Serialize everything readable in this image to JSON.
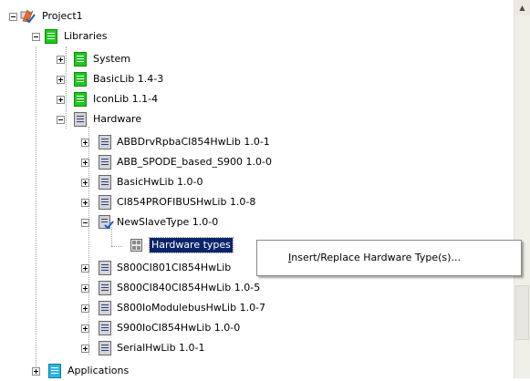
{
  "tree": {
    "project": {
      "label": "Project1",
      "expander": "minus"
    },
    "libraries": {
      "label": "Libraries",
      "expander": "minus"
    },
    "system": {
      "label": "System",
      "expander": "plus"
    },
    "basiclib": {
      "label": "BasicLib 1.4-3",
      "expander": "plus"
    },
    "iconlib": {
      "label": "IconLib 1.1-4",
      "expander": "plus"
    },
    "hardware": {
      "label": "Hardware",
      "expander": "minus"
    },
    "hw_items": [
      {
        "label": "ABBDrvRpbaCI854HwLib 1.0-1",
        "expander": "plus"
      },
      {
        "label": "ABB_SPODE_based_S900 1.0-0",
        "expander": "plus"
      },
      {
        "label": "BasicHwLib 1.0-0",
        "expander": "plus"
      },
      {
        "label": "CI854PROFIBUSHwLib 1.0-8",
        "expander": "plus"
      }
    ],
    "newslave": {
      "label": "NewSlaveType 1.0-0",
      "expander": "minus"
    },
    "hardware_types": {
      "label": "Hardware types",
      "selected": true
    },
    "hw_items_2": [
      {
        "label": "S800CI801CI854HwLib",
        "expander": "plus"
      },
      {
        "label": "S800CI840CI854HwLib 1.0-5",
        "expander": "plus"
      },
      {
        "label": "S800IoModulebusHwLib 1.0-7",
        "expander": "plus"
      },
      {
        "label": "S900IoCI854HwLib 1.0-0",
        "expander": "plus"
      },
      {
        "label": "SerialHwLib 1.0-1",
        "expander": "plus"
      }
    ],
    "applications": {
      "label": "Applications",
      "expander": "plus"
    }
  },
  "context_menu": {
    "item": "Insert/Replace Hardware Type(s)...",
    "mnemonic": "I"
  },
  "icons": {
    "project": "project-icon",
    "library_enabled": "green-library-icon",
    "library_hw": "hardware-library-icon",
    "library_checked": "checked-library-icon",
    "hardware_types": "hardware-types-icon",
    "applications": "applications-icon"
  },
  "colors": {
    "selection": "#0a246a",
    "library_green": "#1ec81e",
    "library_gray": "#d4d4d4",
    "applications_cyan": "#27b7e6"
  }
}
